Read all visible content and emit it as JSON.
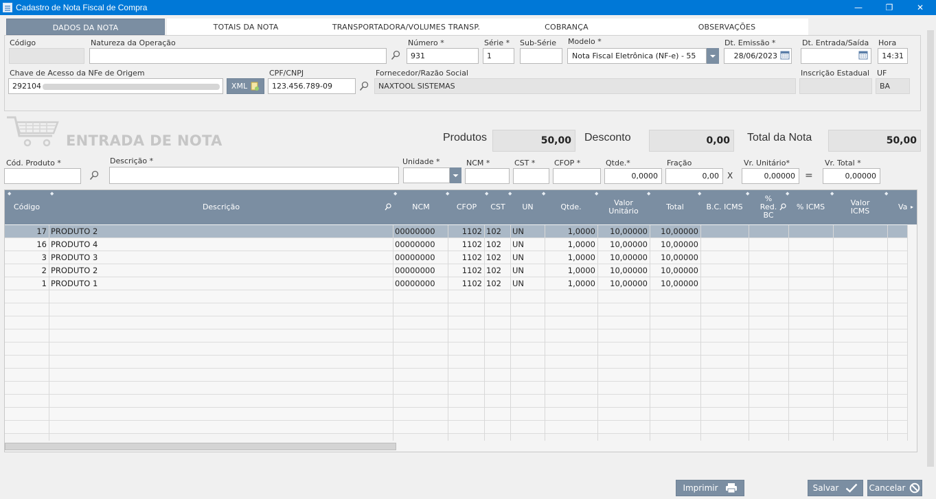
{
  "window": {
    "title": "Cadastro de Nota Fiscal de Compra",
    "minimize": "—",
    "maximize": "❐",
    "close": "✕"
  },
  "tabs": [
    "DADOS DA NOTA",
    "TOTAIS DA NOTA",
    "TRANSPORTADORA/VOLUMES TRANSP.",
    "COBRANÇA",
    "OBSERVAÇÕES"
  ],
  "header": {
    "codigo": {
      "label": "Código",
      "value": ""
    },
    "natureza": {
      "label": "Natureza da Operação",
      "value": ""
    },
    "numero": {
      "label": "Número *",
      "value": "931"
    },
    "serie": {
      "label": "Série *",
      "value": "1"
    },
    "subserie": {
      "label": "Sub-Série",
      "value": ""
    },
    "modelo": {
      "label": "Modelo *",
      "value": "Nota Fiscal Eletrônica (NF-e) - 55"
    },
    "dt_emissao": {
      "label": "Dt. Emissão *",
      "value": "28/06/2023"
    },
    "dt_entrada": {
      "label": "Dt. Entrada/Saída",
      "value": ""
    },
    "hora": {
      "label": "Hora",
      "value": "14:31"
    },
    "chave": {
      "label": "Chave de Acesso da NFe de Origem",
      "value": "292104"
    },
    "xml_button": "XML",
    "cpf_cnpj": {
      "label": "CPF/CNPJ",
      "value": "123.456.789-09"
    },
    "fornecedor": {
      "label": "Fornecedor/Razão Social",
      "value": "NAXTOOL SISTEMAS"
    },
    "inscricao": {
      "label": "Inscrição Estadual",
      "value": ""
    },
    "uf": {
      "label": "UF",
      "value": "BA"
    }
  },
  "entry": {
    "title": "ENTRADA DE NOTA",
    "produtos_label": "Produtos",
    "produtos_value": "50,00",
    "desconto_label": "Desconto",
    "desconto_value": "0,00",
    "total_label": "Total da Nota",
    "total_value": "50,00"
  },
  "item_form": {
    "cod_produto": {
      "label": "Cód. Produto *",
      "value": ""
    },
    "descricao": {
      "label": "Descrição *",
      "value": ""
    },
    "unidade": {
      "label": "Unidade *",
      "value": ""
    },
    "ncm": {
      "label": "NCM *",
      "value": ""
    },
    "cst": {
      "label": "CST *",
      "value": ""
    },
    "cfop": {
      "label": "CFOP *",
      "value": ""
    },
    "qtde": {
      "label": "Qtde.*",
      "value": "0,0000"
    },
    "fracao": {
      "label": "Fração",
      "value": "0,00"
    },
    "times": "X",
    "vr_unitario": {
      "label": "Vr. Unitário*",
      "value": "0,00000"
    },
    "equals": "=",
    "vr_total": {
      "label": "Vr. Total *",
      "value": "0,00000"
    }
  },
  "grid": {
    "columns": [
      "Código",
      "Descrição",
      "NCM",
      "CFOP",
      "CST",
      "UN",
      "Qtde.",
      "Valor Unitário",
      "Total",
      "B.C. ICMS",
      "% Red. BC",
      "% ICMS",
      "Valor ICMS",
      "Va"
    ],
    "rows": [
      {
        "codigo": "17",
        "descricao": "PRODUTO 2",
        "ncm": "00000000",
        "cfop": "1102",
        "cst": "102",
        "un": "UN",
        "qtde": "1,0000",
        "vunit": "10,00000",
        "total": "10,00000"
      },
      {
        "codigo": "16",
        "descricao": "PRODUTO 4",
        "ncm": "00000000",
        "cfop": "1102",
        "cst": "102",
        "un": "UN",
        "qtde": "1,0000",
        "vunit": "10,00000",
        "total": "10,00000"
      },
      {
        "codigo": "3",
        "descricao": "PRODUTO 3",
        "ncm": "00000000",
        "cfop": "1102",
        "cst": "102",
        "un": "UN",
        "qtde": "1,0000",
        "vunit": "10,00000",
        "total": "10,00000"
      },
      {
        "codigo": "2",
        "descricao": "PRODUTO 2",
        "ncm": "00000000",
        "cfop": "1102",
        "cst": "102",
        "un": "UN",
        "qtde": "1,0000",
        "vunit": "10,00000",
        "total": "10,00000"
      },
      {
        "codigo": "1",
        "descricao": "PRODUTO 1",
        "ncm": "00000000",
        "cfop": "1102",
        "cst": "102",
        "un": "UN",
        "qtde": "1,0000",
        "vunit": "10,00000",
        "total": "10,00000"
      }
    ]
  },
  "footer": {
    "imprimir": "Imprimir",
    "salvar": "Salvar",
    "cancelar": "Cancelar"
  }
}
